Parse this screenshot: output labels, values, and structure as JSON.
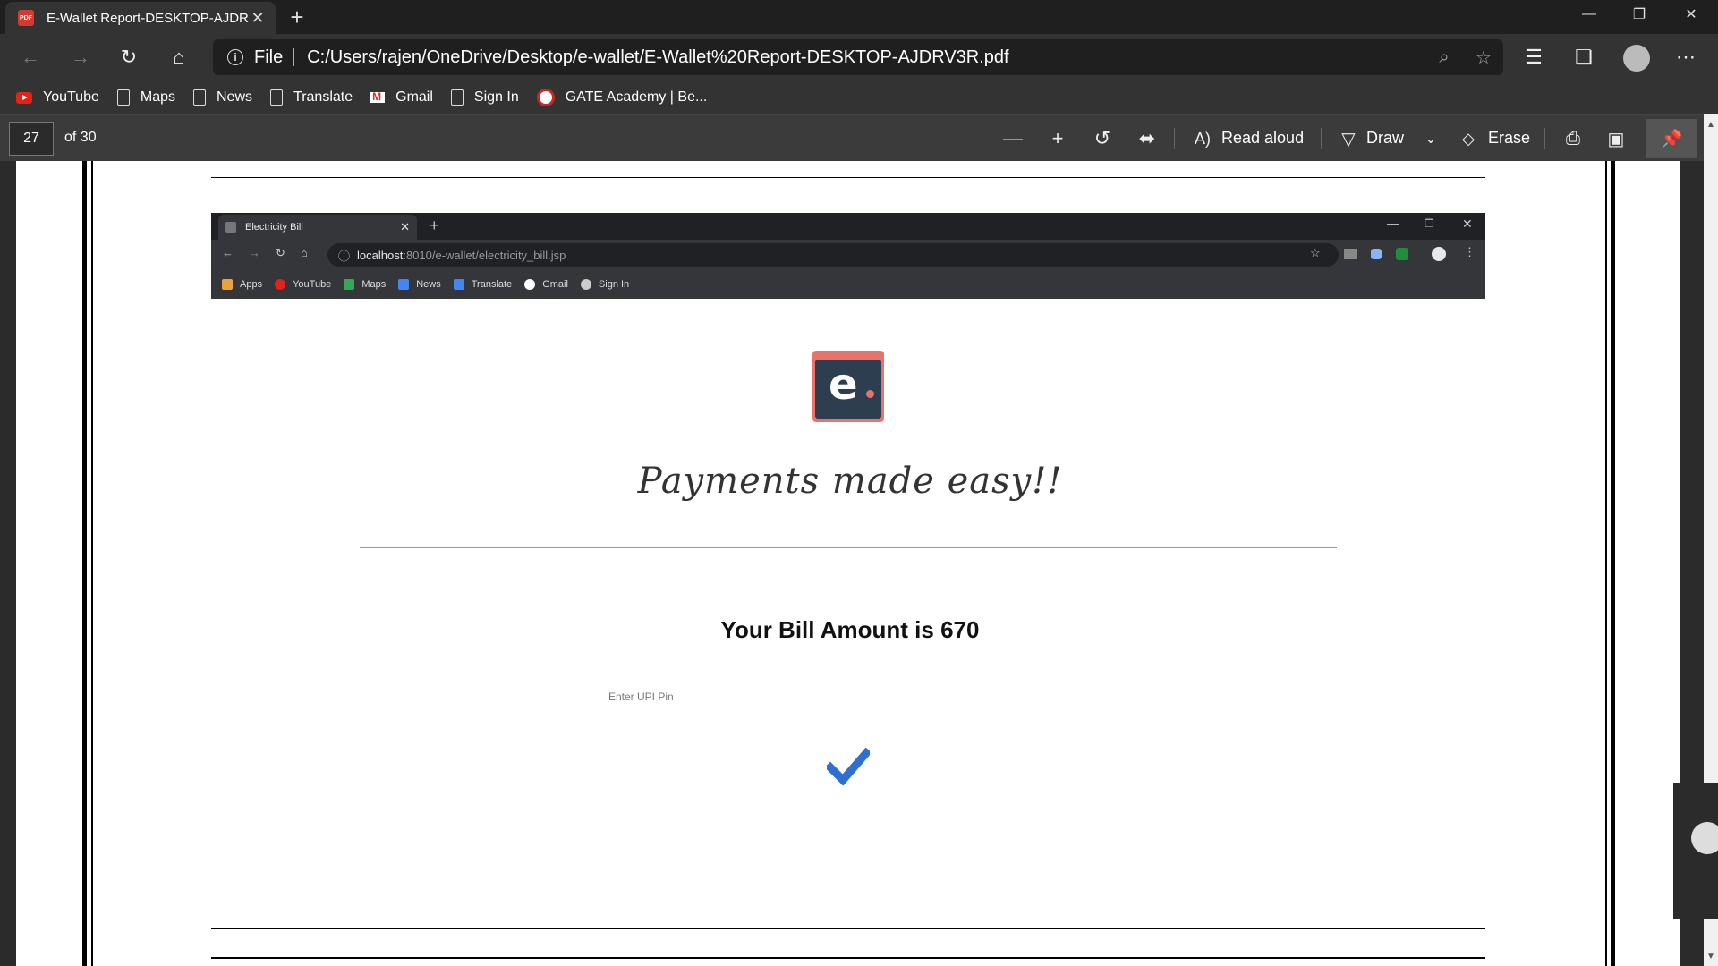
{
  "tab": {
    "title": "E-Wallet Report-DESKTOP-AJDR\\",
    "close": "✕",
    "new_tab": "+"
  },
  "window": {
    "minimize": "—",
    "restore": "❐",
    "close": "✕"
  },
  "address_bar": {
    "scheme_label": "File",
    "url": "C:/Users/rajen/OneDrive/Desktop/e-wallet/E-Wallet%20Report-DESKTOP-AJDRV3R.pdf"
  },
  "bookmarks": [
    {
      "label": "YouTube",
      "icon": "youtube-icon"
    },
    {
      "label": "Maps",
      "icon": "page-icon"
    },
    {
      "label": "News",
      "icon": "page-icon"
    },
    {
      "label": "Translate",
      "icon": "page-icon"
    },
    {
      "label": "Gmail",
      "icon": "gmail-icon"
    },
    {
      "label": "Sign In",
      "icon": "page-icon"
    },
    {
      "label": "GATE Academy | Be...",
      "icon": "gate-icon"
    }
  ],
  "pdf_toolbar": {
    "current_page": "27",
    "total_pages": "of 30",
    "read_aloud": "Read aloud",
    "draw": "Draw",
    "erase": "Erase"
  },
  "embedded_browser": {
    "tab_title": "Electricity Bill",
    "url_host": "localhost",
    "url_path": ":8010/e-wallet/electricity_bill.jsp",
    "bookmarks": [
      {
        "label": "Apps",
        "color": "#e8a33d"
      },
      {
        "label": "YouTube",
        "color": "#e62117"
      },
      {
        "label": "Maps",
        "color": "#34a853"
      },
      {
        "label": "News",
        "color": "#4285f4"
      },
      {
        "label": "Translate",
        "color": "#4285f4"
      },
      {
        "label": "Gmail",
        "color": "#ffffff"
      },
      {
        "label": "Sign In",
        "color": "#cccccc"
      }
    ]
  },
  "content": {
    "logo_letter": "e",
    "tagline": "Payments made easy!!",
    "bill_text": "Your Bill Amount is 670",
    "upi_label": "Enter UPI Pin",
    "accent": "#2f6fcf"
  }
}
